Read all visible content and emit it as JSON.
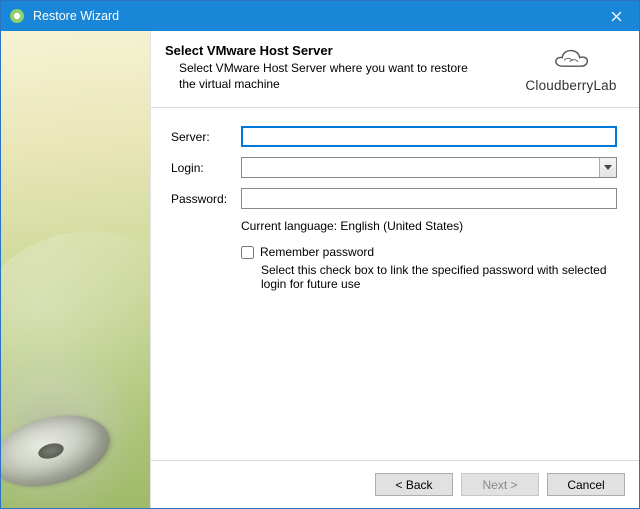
{
  "window": {
    "title": "Restore Wizard",
    "close_icon": "close"
  },
  "brand": {
    "name": "CloudberryLab",
    "icon": "cloud"
  },
  "header": {
    "title": "Select VMware Host Server",
    "subtitle": "Select VMware Host Server where you want to restore the virtual machine"
  },
  "form": {
    "server": {
      "label": "Server:",
      "value": ""
    },
    "login": {
      "label": "Login:",
      "value": "",
      "options": []
    },
    "password": {
      "label": "Password:",
      "value": ""
    },
    "language_line": "Current language: English (United States)",
    "remember": {
      "label": "Remember password",
      "checked": false,
      "hint": "Select this check box to link the specified password with selected login for future use"
    }
  },
  "buttons": {
    "back": "< Back",
    "next": "Next >",
    "cancel": "Cancel",
    "next_enabled": false
  }
}
